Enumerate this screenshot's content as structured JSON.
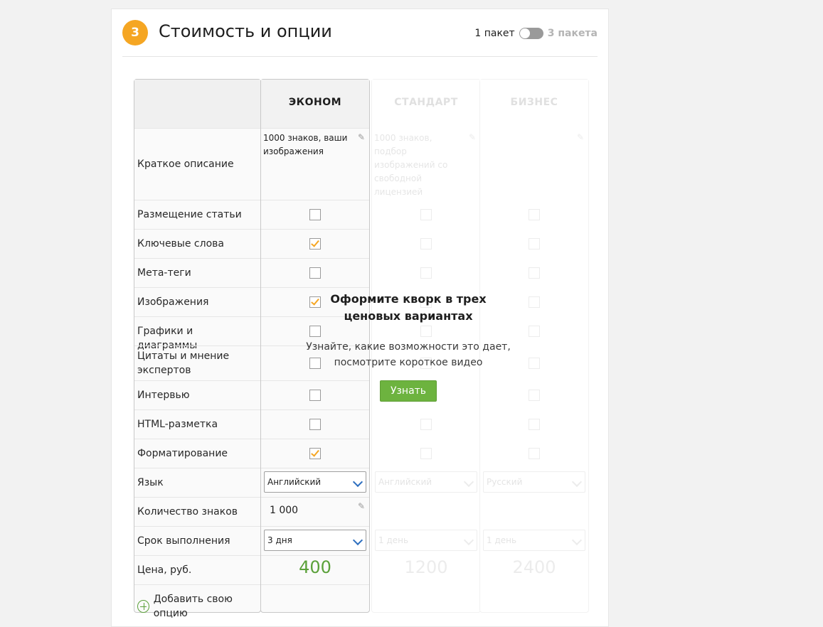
{
  "section": {
    "step_number": "3",
    "title": "Стоимость и опции",
    "toggle_one": "1 пакет",
    "toggle_three": "3 пакета"
  },
  "labels": {
    "description": "Краткое описание",
    "rows": [
      "Размещение статьи",
      "Ключевые слова",
      "Мета-теги",
      "Изображения",
      "Графики и диаграммы",
      "Цитаты и мнение экспертов",
      "Интервью",
      "HTML-разметка",
      "Форматирование"
    ],
    "language": "Язык",
    "chars": "Количество знаков",
    "deadline": "Срок выполнения",
    "price": "Цена, руб.",
    "add_option": "Добавить свою опцию"
  },
  "packages": [
    {
      "name": "ЭКОНОМ",
      "description": "1000 знаков, ваши изображения",
      "checks": [
        false,
        true,
        false,
        true,
        false,
        false,
        false,
        false,
        true
      ],
      "language": "Английский",
      "chars": "1 000",
      "deadline": "3 дня",
      "price": "400"
    },
    {
      "name": "СТАНДАРТ",
      "description": "1000 знаков, подбор изображений со свободной лицензией",
      "checks": [
        false,
        false,
        false,
        false,
        false,
        false,
        false,
        false,
        false
      ],
      "language": "Английский",
      "chars": "",
      "deadline": "1 день",
      "price": "1200"
    },
    {
      "name": "БИЗНЕС",
      "description": "",
      "checks": [
        false,
        false,
        false,
        false,
        false,
        false,
        false,
        false,
        false
      ],
      "language": "Русский",
      "chars": "",
      "deadline": "1 день",
      "price": "2400"
    }
  ],
  "promo": {
    "title": "Оформите кворк в трех ценовых вариантах",
    "text": "Узнайте, какие возможности это дает, посмотрите короткое видео",
    "button": "Узнать"
  },
  "colors": {
    "accent": "#f5a623",
    "price_green": "#5ba13a",
    "button_green": "#6db33f",
    "select_chevron": "#2e6fbf"
  },
  "icons": {
    "edit": "pencil-icon",
    "add": "plus-circle-icon",
    "dropdown": "chevron-down-icon"
  }
}
